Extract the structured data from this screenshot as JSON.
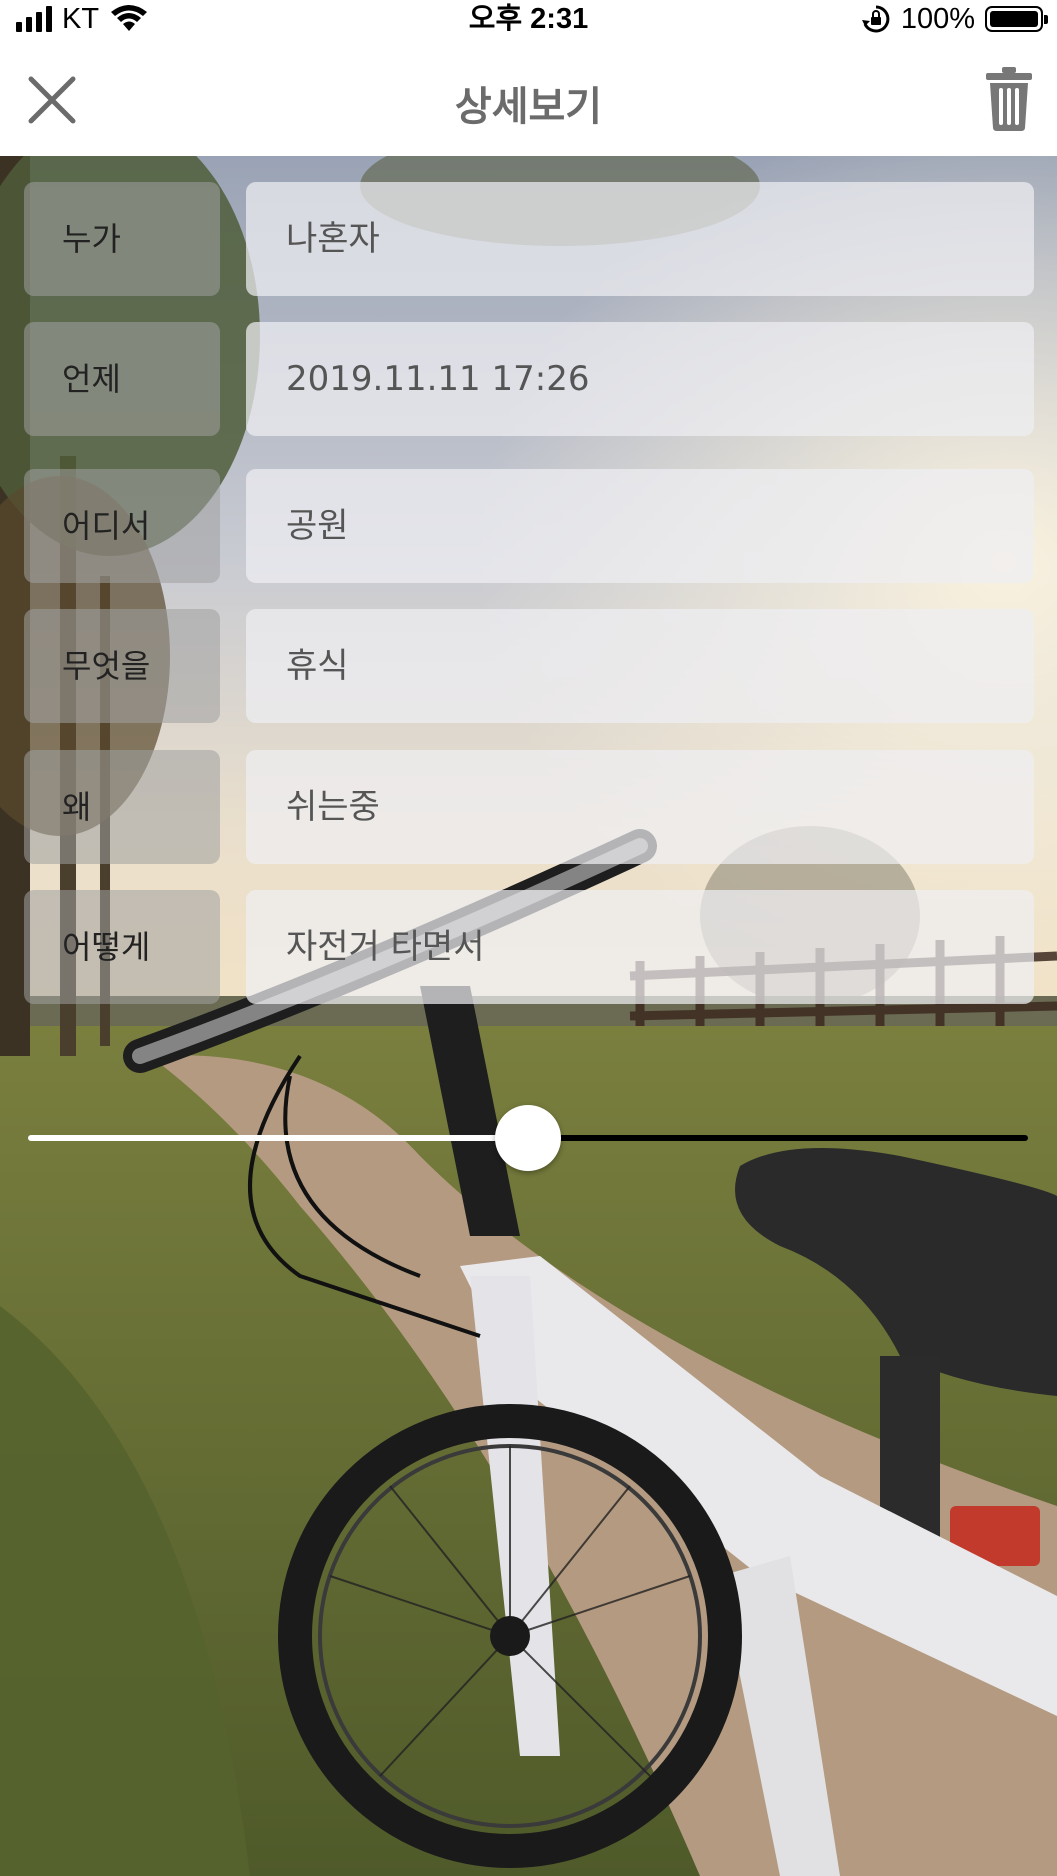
{
  "status_bar": {
    "carrier": "KT",
    "time": "오후 2:31",
    "battery_percent": "100%"
  },
  "nav": {
    "title": "상세보기",
    "close_icon": "close-icon",
    "delete_icon": "trash-icon"
  },
  "details": [
    {
      "label": "누가",
      "value": "나혼자"
    },
    {
      "label": "언제",
      "value": "2019.11.11 17:26"
    },
    {
      "label": "어디서",
      "value": "공원"
    },
    {
      "label": "무엇을",
      "value": "휴식"
    },
    {
      "label": "왜",
      "value": "쉬는중"
    },
    {
      "label": "어떻게",
      "value": "자전거 타면서"
    }
  ],
  "playback_slider": {
    "progress_fraction": 0.5
  }
}
